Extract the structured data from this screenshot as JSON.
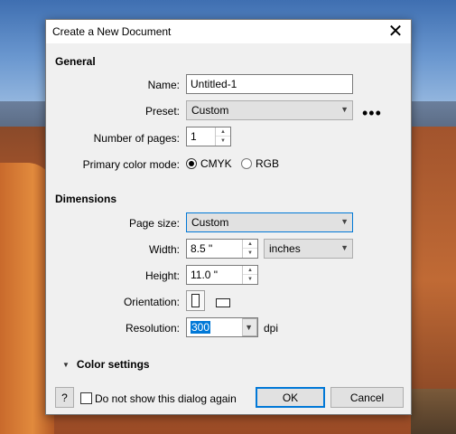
{
  "dialog": {
    "title": "Create a New Document",
    "close_glyph": "✕"
  },
  "general": {
    "heading": "General",
    "name_label": "Name:",
    "name_value": "Untitled-1",
    "preset_label": "Preset:",
    "preset_value": "Custom",
    "more_options": "•••",
    "pages_label": "Number of pages:",
    "pages_value": "1",
    "color_mode_label": "Primary color mode:",
    "color_modes": [
      {
        "label": "CMYK",
        "selected": true
      },
      {
        "label": "RGB",
        "selected": false
      }
    ]
  },
  "dimensions": {
    "heading": "Dimensions",
    "page_size_label": "Page size:",
    "page_size_value": "Custom",
    "width_label": "Width:",
    "width_value": "8.5 \"",
    "units_value": "inches",
    "height_label": "Height:",
    "height_value": "11.0 \"",
    "orientation_label": "Orientation:",
    "orientation_selected": "portrait",
    "resolution_label": "Resolution:",
    "resolution_value": "300",
    "resolution_unit": "dpi"
  },
  "color_settings": {
    "label": "Color settings",
    "expanded": false
  },
  "footer": {
    "help_label": "?",
    "dont_show_label": "Do not show this dialog again",
    "dont_show_checked": false,
    "ok_label": "OK",
    "cancel_label": "Cancel"
  },
  "icons": {
    "dropdown_arrow": "▼",
    "spin_up": "▲",
    "spin_down": "▼",
    "expander": "▼"
  }
}
